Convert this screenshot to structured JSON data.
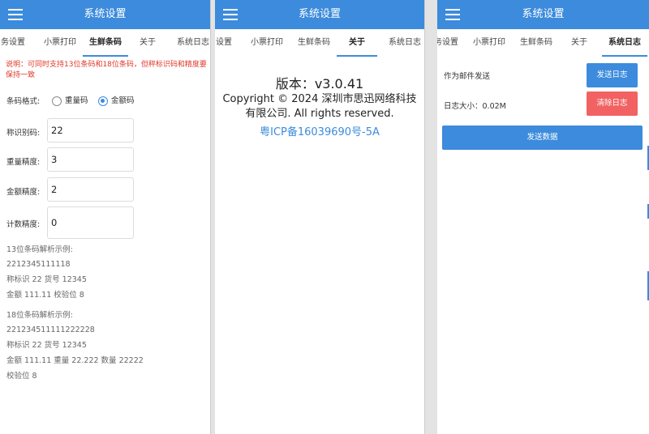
{
  "app": {
    "title": "系统设置"
  },
  "panels": [
    {
      "tabs": [
        "务设置",
        "小票打印",
        "生鲜条码",
        "关于",
        "系统日志"
      ],
      "active_tab": "生鲜条码",
      "note": "说明：可同时支持13位条码和18位条码，但秤标识码和精度要保持一致",
      "barcode_format": {
        "label": "条码格式:",
        "options": [
          "重量码",
          "金额码"
        ],
        "selected": "金额码"
      },
      "fields": [
        {
          "label": "称识别码:",
          "value": "22"
        },
        {
          "label": "重量精度:",
          "value": "3"
        },
        {
          "label": "金额精度:",
          "value": "2"
        },
        {
          "label": "计数精度:",
          "value": "0"
        }
      ],
      "example13": {
        "title": "13位条码解析示例:",
        "code": "2212345111118",
        "line1": "称标识 22   货号 12345",
        "line2": "金额 111.11   校验位 8"
      },
      "example18": {
        "title": "18位条码解析示例:",
        "code": "221234511111222228",
        "line1": "称标识 22   货号 12345",
        "line2": "金额 111.11   重量 22.222   数量 22222",
        "line3": "校验位 8"
      }
    },
    {
      "tabs": [
        "设置",
        "小票打印",
        "生鲜条码",
        "关于",
        "系统日志"
      ],
      "active_tab": "关于",
      "version": "版本：v3.0.41",
      "copyright": "Copyright © 2024 深圳市思迅网络科技有限公司. All rights reserved.",
      "icp": "粤ICP备16039690号-5A"
    },
    {
      "tabs": [
        "务设置",
        "小票打印",
        "生鲜条码",
        "关于",
        "系统日志"
      ],
      "active_tab": "系统日志",
      "email_label": "作为邮件发送",
      "send_log_button": "发送日志",
      "log_size_label": "日志大小：0.02M",
      "clear_log_button": "清除日志",
      "send_data_button": "发送数据"
    }
  ],
  "colors": {
    "primary": "#3c8bdc",
    "danger": "#f26262",
    "note": "#e0382a"
  }
}
